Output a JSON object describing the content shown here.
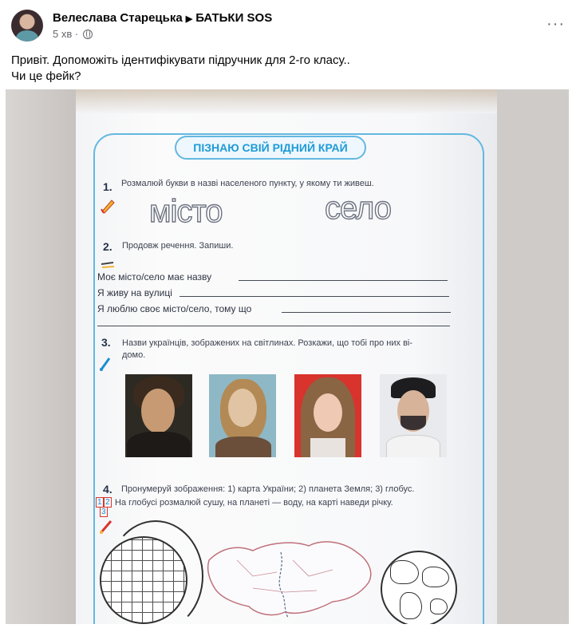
{
  "post": {
    "author": "Велеслава Старецька",
    "group": "БАТЬКИ SOS",
    "time": "5 хв",
    "more_label": "···",
    "text_line1": "Привіт. Допоможіть ідентифікувати підручник для 2-го класу..",
    "text_line2": "Чи це фейк?"
  },
  "textbook": {
    "title": "ПІЗНАЮ СВІЙ РІДНИЙ КРАЙ",
    "task1": {
      "num": "1.",
      "text": "Розмалюй букви в назві населеного пункту, у якому ти живеш.",
      "word1": "місто",
      "word2": "село"
    },
    "task2": {
      "num": "2.",
      "text": "Продовж речення. Запиши.",
      "line1": "Моє місто/село має назву",
      "line2": "Я живу на вулиці",
      "line3": "Я люблю своє місто/село, тому що"
    },
    "task3": {
      "num": "3.",
      "text_line1": "Назви українців, зображених на світлинах. Розкажи, що тобі про них ві-",
      "text_line2": "домо."
    },
    "task4": {
      "num": "4.",
      "text_line1": "Пронумеруй зображення: 1) карта України; 2) планета Земля; 3) глобус.",
      "text_line2": "На глобусі розмалюй сушу, на планеті — воду, на карті наведи річку.",
      "box1": "1",
      "box2": "2",
      "box3": "3"
    }
  }
}
